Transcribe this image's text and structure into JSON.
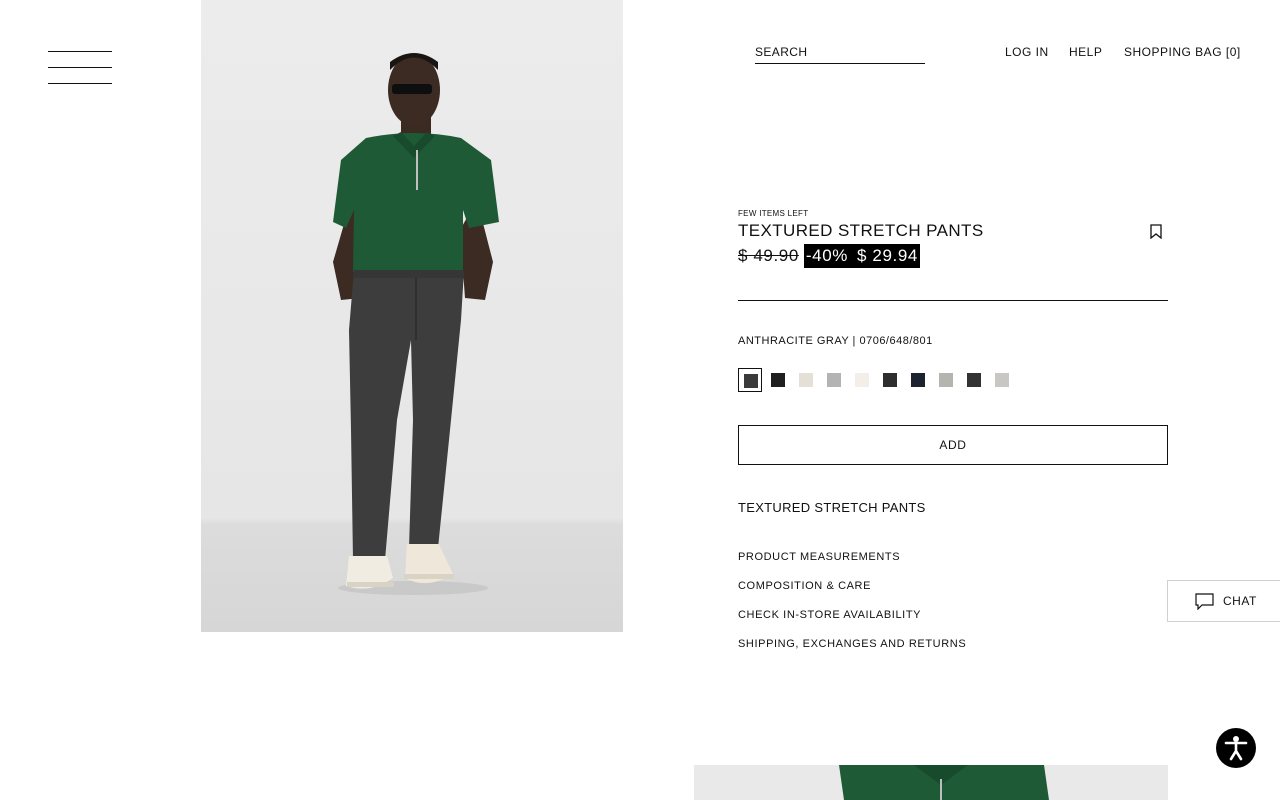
{
  "header": {
    "search_placeholder": "SEARCH",
    "login_label": "LOG IN",
    "help_label": "HELP",
    "bag_label": "SHOPPING BAG [0]"
  },
  "product": {
    "stock_note": "FEW ITEMS LEFT",
    "title": "TEXTURED STRETCH PANTS",
    "price_original": "$ 49.90",
    "discount": "-40%",
    "price_sale": "$ 29.94",
    "color_info": "ANTHRACITE GRAY | 0706/648/801",
    "swatches": [
      {
        "color": "#3a3a3a",
        "selected": true
      },
      {
        "color": "#1f1f1f"
      },
      {
        "color": "#e4e0d6"
      },
      {
        "color": "#b3b3b3"
      },
      {
        "color": "#f3efe8"
      },
      {
        "color": "#2e2e2e"
      },
      {
        "color": "#1c2230"
      },
      {
        "color": "#b5b5b0"
      },
      {
        "color": "#333333"
      },
      {
        "color": "#c8c7c3"
      }
    ],
    "add_label": "ADD",
    "description_title": "TEXTURED STRETCH PANTS",
    "info_links": [
      "PRODUCT MEASUREMENTS",
      "COMPOSITION & CARE",
      "CHECK IN-STORE AVAILABILITY",
      "SHIPPING, EXCHANGES AND RETURNS"
    ]
  },
  "chat": {
    "label": "CHAT"
  },
  "icons": {
    "menu": "hamburger-menu-icon",
    "bookmark": "bookmark-icon",
    "chat": "chat-bubble-icon",
    "accessibility": "accessibility-icon"
  }
}
